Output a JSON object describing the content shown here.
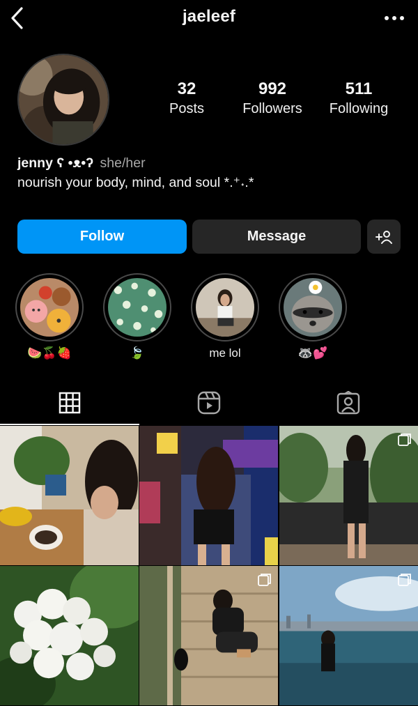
{
  "header": {
    "username": "jaeleef"
  },
  "stats": [
    {
      "value": "32",
      "label": "Posts"
    },
    {
      "value": "992",
      "label": "Followers"
    },
    {
      "value": "511",
      "label": "Following"
    }
  ],
  "bio": {
    "name": "jenny ʕ •ᴥ•ʔ",
    "pronouns": "she/her",
    "text": "nourish your body, mind, and soul *.⁺˖.*"
  },
  "actions": {
    "follow": "Follow",
    "message": "Message"
  },
  "highlights": [
    {
      "label": "🍉🍒🍓"
    },
    {
      "label": "🍃"
    },
    {
      "label": "me lol"
    },
    {
      "label": "🦝💕"
    }
  ],
  "tabs": [
    {
      "name": "posts-grid",
      "icon": "grid-icon",
      "active": true
    },
    {
      "name": "reels",
      "icon": "reels-icon",
      "active": false
    },
    {
      "name": "tagged",
      "icon": "tagged-icon",
      "active": false
    }
  ],
  "icons": {
    "back": "chevron-left-icon",
    "more": "more-horizontal-icon",
    "suggest": "add-person-icon",
    "multi": "carousel-icon"
  },
  "colors": {
    "background": "#000000",
    "follow_button": "#0095f6",
    "secondary_button": "#262626",
    "text": "#f5f5f5",
    "muted_text": "#a8a8a8"
  }
}
